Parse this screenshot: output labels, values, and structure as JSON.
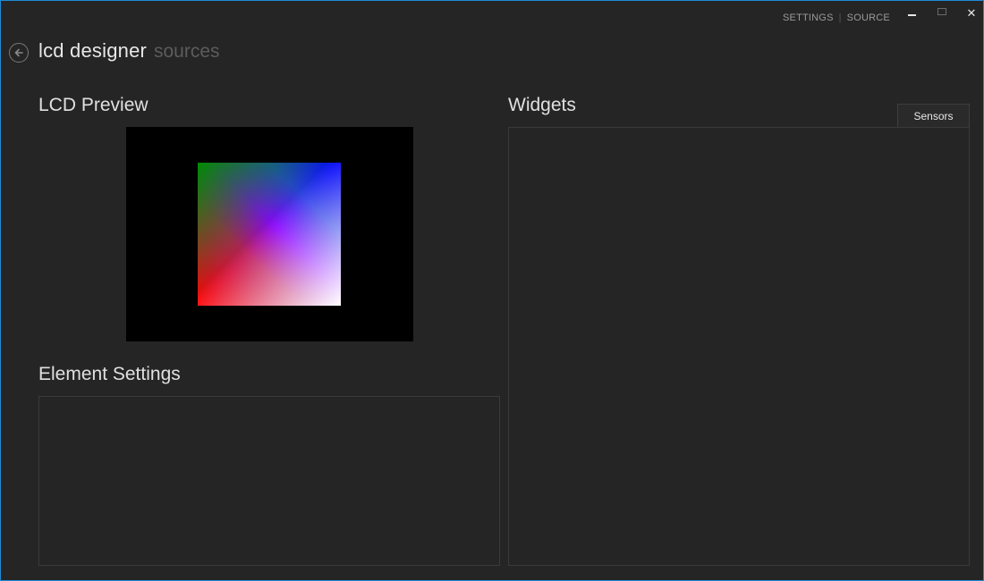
{
  "app": {
    "title": "lcd designer",
    "subtitle": "sources"
  },
  "topnav": {
    "settings": "SETTINGS",
    "separator": "|",
    "source": "SOURCE"
  },
  "window_controls": {
    "close_glyph": "✕"
  },
  "sections": {
    "lcd_preview": "LCD Preview",
    "widgets": "Widgets",
    "element_settings": "Element Settings"
  },
  "buttons": {
    "sensors": "Sensors"
  },
  "icons": {
    "back": "back-arrow-icon",
    "minimize": "minimize-icon",
    "maximize": "maximize-icon",
    "close": "close-icon"
  },
  "colors": {
    "background": "#252525",
    "window_border": "#1e8ad6",
    "lcd_background": "#000000"
  }
}
